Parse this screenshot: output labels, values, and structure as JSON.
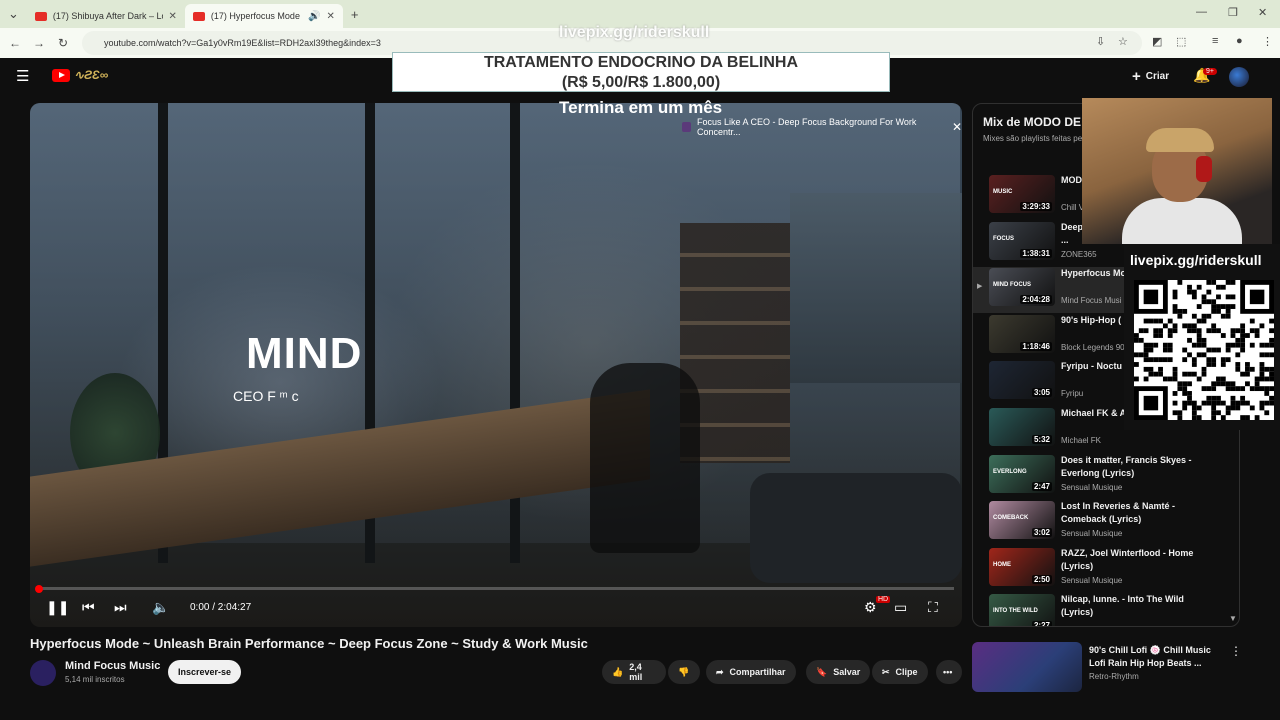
{
  "browser": {
    "tabs": [
      {
        "title": "(17) Shibuya After Dark – Lofi H",
        "active": false
      },
      {
        "title": "(17) Hyperfocus Mode – U",
        "active": true
      }
    ],
    "url": "youtube.com/watch?v=Ga1y0vRm19E&list=RDH2axl39theg&index=3"
  },
  "overlay": {
    "top_watermark": "livepix.gg/riderskull",
    "banner_line1": "TRATAMENTO ENDOCRINO DA BELINHA",
    "banner_line2": "(R$ 5,00/R$ 1.800,00)",
    "countdown": "Termina em um mês",
    "qr_label": "livepix.gg/riderskull"
  },
  "header": {
    "create_label": "Criar",
    "notifications_badge": "9+"
  },
  "player": {
    "overlay_title": "Focus Like A CEO - Deep Focus Background For Work Concentr...",
    "scene_big_text": "MIND",
    "scene_small_text": "CEO F  ᵐ  c",
    "time": "0:00 / 2:04:27",
    "progress_fraction": 0.001,
    "hd_badge": "HD"
  },
  "video": {
    "title": "Hyperfocus Mode ~ Unleash Brain Performance ~ Deep Focus Zone ~ Study & Work Music",
    "channel": "Mind Focus Music",
    "subscribers": "5,14 mil inscritos",
    "subscribe_label": "Inscrever-se",
    "likes": "2,4 mil",
    "share_label": "Compartilhar",
    "save_label": "Salvar",
    "clip_label": "Clipe"
  },
  "mix": {
    "title": "Mix de MODO DE",
    "subtitle": "Mixes são playlists feitas pe",
    "items": [
      {
        "title": "MODO PROF",
        "channel": "Chill V",
        "duration": "3:29:33",
        "thumb": "#5a2020",
        "thumb_text": "MUSIC"
      },
      {
        "title": "Deep Beats for High-Concentration ...",
        "channel": "ZONE365",
        "duration": "1:38:31",
        "thumb": "#3b4048",
        "thumb_text": "FOCUS"
      },
      {
        "title": "Hyperfocus Mo Brain Performa",
        "channel": "Mind Focus Musi",
        "duration": "2:04:28",
        "thumb": "#4a4d55",
        "thumb_text": "MIND FOCUS",
        "active": true
      },
      {
        "title": "90's Hip-Hop ( Demos] B.I.G.",
        "channel": "Block Legends 90",
        "duration": "1:18:46",
        "thumb": "#3c3a2f",
        "thumb_text": ""
      },
      {
        "title": "Fyripu - Noctu [Atmospheric S",
        "channel": "Fyripu",
        "duration": "3:05",
        "thumb": "#1e2634",
        "thumb_text": ""
      },
      {
        "title": "Michael FK & A Falling Apart",
        "channel": "Michael FK",
        "duration": "5:32",
        "thumb": "#2a5a58",
        "thumb_text": ""
      },
      {
        "title": "Does it matter, Francis Skyes - Everlong (Lyrics)",
        "channel": "Sensual Musique",
        "duration": "2:47",
        "thumb": "#3c6e5a",
        "thumb_text": "EVERLONG"
      },
      {
        "title": "Lost In Reveries & Namté - Comeback (Lyrics)",
        "channel": "Sensual Musique",
        "duration": "3:02",
        "thumb": "#b08aa0",
        "thumb_text": "COMEBACK"
      },
      {
        "title": "RAZZ, Joel Winterflood - Home (Lyrics)",
        "channel": "Sensual Musique",
        "duration": "2:50",
        "thumb": "#a0261a",
        "thumb_text": "HOME"
      },
      {
        "title": "Nilcap, lunne. - Into The Wild (Lyrics)",
        "channel": "",
        "duration": "2:27",
        "thumb": "#355a45",
        "thumb_text": "INTO THE WILD"
      }
    ]
  },
  "next": {
    "title": "90's Chill Lofi 🍥 Chill Music Lofi Rain Hip Hop Beats ...",
    "channel": "Retro-Rhythm"
  },
  "colors": {
    "accent": "#ff0000",
    "background": "#0f0f0f",
    "surface": "#272727"
  }
}
